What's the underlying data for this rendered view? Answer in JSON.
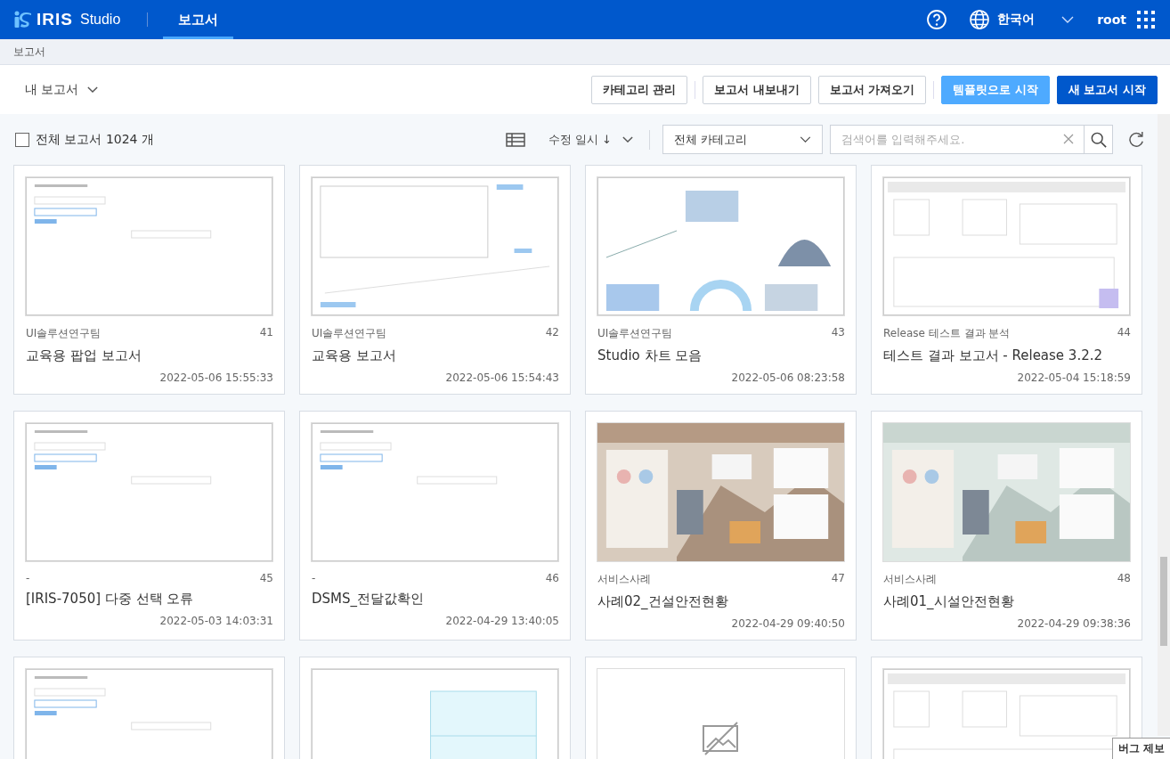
{
  "header": {
    "logo": "IRIS",
    "product": "Studio",
    "nav": [
      {
        "label": "보고서",
        "selected": true
      }
    ],
    "language": "한국어",
    "user": "root"
  },
  "breadcrumb": "보고서",
  "toolbar": {
    "scope": "내 보고서",
    "buttons": [
      {
        "label": "카테고리 관리",
        "kind": "outline"
      },
      {
        "label": "보고서 내보내기",
        "kind": "outline"
      },
      {
        "label": "보고서 가져오기",
        "kind": "outline"
      },
      {
        "label": "템플릿으로 시작",
        "kind": "light"
      },
      {
        "label": "새 보고서 시작",
        "kind": "primary"
      }
    ]
  },
  "filter": {
    "select_all": {
      "label": "전체 보고서 1024 개",
      "checked": false
    },
    "sort": "수정 일시 ↓",
    "category": "전체 카테고리",
    "search": {
      "placeholder": "검색어를 입력해주세요."
    }
  },
  "cards": [
    {
      "kind": "form",
      "category": "UI솔루션연구팀",
      "number": "41",
      "title": "교육용 팝업 보고서",
      "modified": "2022-05-06 15:55:33"
    },
    {
      "kind": "chart",
      "category": "UI솔루션연구팀",
      "number": "42",
      "title": "교육용 보고서",
      "modified": "2022-05-06 15:54:43"
    },
    {
      "kind": "dashboard",
      "category": "UI솔루션연구팀",
      "number": "43",
      "title": "Studio 차트 모음",
      "modified": "2022-05-06 08:23:58"
    },
    {
      "kind": "document",
      "category": "Release 테스트 결과 분석",
      "number": "44",
      "title": "테스트 결과 보고서 - Release 3.2.2",
      "modified": "2022-05-04 15:18:59"
    },
    {
      "kind": "form",
      "category": "-",
      "number": "45",
      "title": "[IRIS-7050] 다중 선택 오류",
      "modified": "2022-05-03 14:03:31"
    },
    {
      "kind": "form",
      "category": "-",
      "number": "46",
      "title": "DSMS_전달값확인",
      "modified": "2022-04-29 13:40:05"
    },
    {
      "kind": "picture",
      "category": "서비스사례",
      "number": "47",
      "title": "사례02_건설안전현황",
      "modified": "2022-04-29 09:40:50"
    },
    {
      "kind": "picture",
      "category": "서비스사례",
      "number": "48",
      "title": "사례01_시설안전현황",
      "modified": "2022-04-29 09:38:36"
    },
    {
      "kind": "form"
    },
    {
      "kind": "panel"
    },
    {
      "kind": "none"
    },
    {
      "kind": "document"
    }
  ],
  "bug_report": "버그 제보"
}
